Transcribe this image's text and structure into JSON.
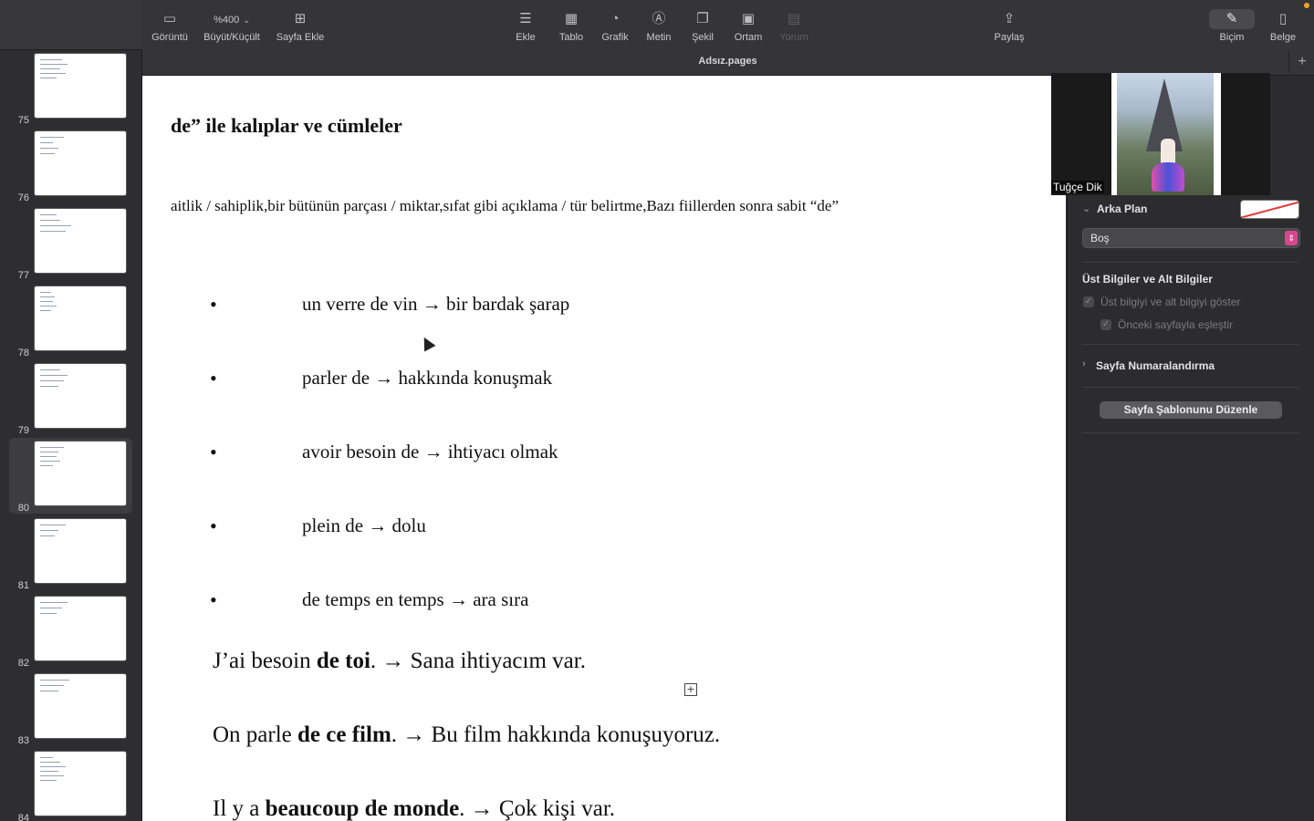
{
  "toolbar": {
    "view_label": "Görüntü",
    "zoom_value": "%400",
    "zoom_label": "Büyüt/Küçült",
    "add_page_label": "Sayfa Ekle",
    "insert_label": "Ekle",
    "table_label": "Tablo",
    "chart_label": "Grafik",
    "text_label": "Metin",
    "shape_label": "Şekil",
    "media_label": "Ortam",
    "comment_label": "Yorum",
    "share_label": "Paylaş",
    "format_label": "Biçim",
    "document_label": "Belge"
  },
  "document_title": "Adsız.pages",
  "sidebar": {
    "pages": [
      {
        "number": "75"
      },
      {
        "number": "76"
      },
      {
        "number": "77"
      },
      {
        "number": "78"
      },
      {
        "number": "79"
      },
      {
        "number": "80",
        "selected": true
      },
      {
        "number": "81"
      },
      {
        "number": "82"
      },
      {
        "number": "83"
      },
      {
        "number": "84"
      }
    ]
  },
  "canvas": {
    "heading": "de” ile kalıplar ve cümleler",
    "intro": "aitlik / sahiplik,bir bütünün parçası / miktar,sıfat gibi açıklama / tür belirtme,Bazı fiillerden sonra sabit “de”",
    "bullets": [
      "un verre de vin → bir bardak şarap",
      "parler de → hakkında konuşmak",
      "avoir besoin de → ihtiyacı olmak",
      "plein de → dolu",
      "de temps en temps → ara sıra"
    ],
    "examples": [
      {
        "before": "J’ai besoin ",
        "bold": "de toi",
        "after": ". → Sana ihtiyacım var."
      },
      {
        "before": "On parle ",
        "bold": "de ce film",
        "after": ". → Bu film hakkında konuşuyoruz."
      },
      {
        "before": "Il y a ",
        "bold": "beaucoup de monde",
        "after": ". → Çok kişi var."
      }
    ]
  },
  "video_overlay": {
    "participant_name": "Tuğçe Dik"
  },
  "inspector": {
    "background_section": "Arka Plan",
    "background_fill_value": "Boş",
    "header_footer_section": "Üst Bilgiler ve Alt Bilgiler",
    "show_header_footer_label": "Üst bilgiyi ve alt bilgiyi göster",
    "match_previous_label": "Önceki sayfayla eşleştir",
    "page_numbering_label": "Sayfa Numaralandırma",
    "edit_template_button": "Sayfa Şablonunu Düzenle"
  },
  "colors": {
    "accent_select": "#d9468f",
    "notification_dot": "#f0a22c"
  }
}
